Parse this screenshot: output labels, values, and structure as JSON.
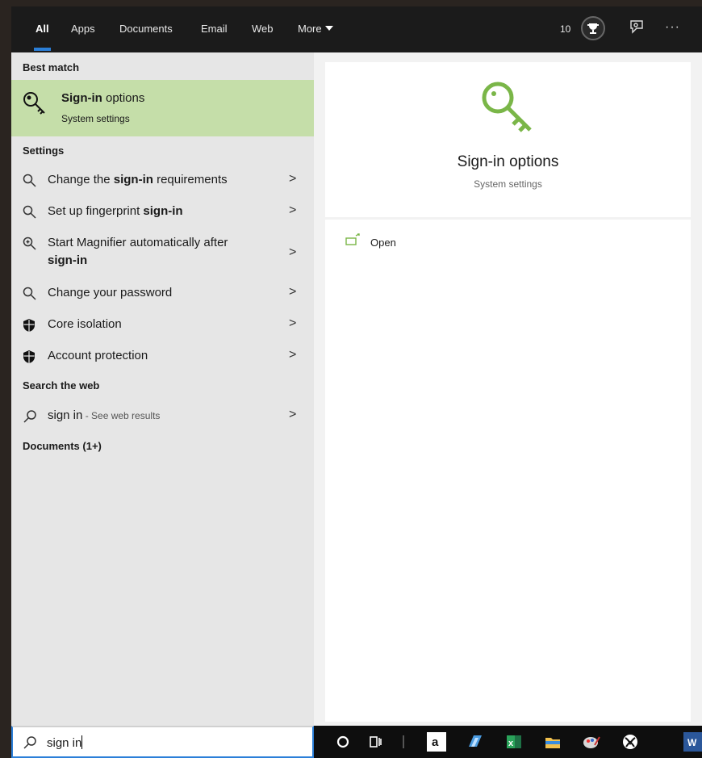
{
  "topbar": {
    "tabs": [
      "All",
      "Apps",
      "Documents",
      "Email",
      "Web",
      "More"
    ],
    "points": "10"
  },
  "left": {
    "best_match_label": "Best match",
    "best_match": {
      "title_bold": "Sign-in",
      "title_rest": " options",
      "subtitle": "System settings"
    },
    "settings_label": "Settings",
    "settings_items": [
      {
        "pre": "Change the ",
        "bold": "sign-in",
        "post": " requirements"
      },
      {
        "pre": "Set up fingerprint ",
        "bold": "sign-in",
        "post": ""
      },
      {
        "pre": "Start Magnifier automatically after",
        "bold": "sign-in",
        "post": ""
      },
      {
        "pre": "Change your password",
        "bold": "",
        "post": ""
      },
      {
        "pre": "Core isolation",
        "bold": "",
        "post": ""
      },
      {
        "pre": "Account protection",
        "bold": "",
        "post": ""
      }
    ],
    "web_label": "Search the web",
    "web_item": {
      "query": "sign in",
      "suffix": " - See web results"
    },
    "docs_label": "Documents (1+)"
  },
  "right": {
    "title": "Sign-in options",
    "subtitle": "System settings",
    "action_open": "Open"
  },
  "search": {
    "value": "sign in"
  },
  "colors": {
    "accent": "#2b7fd8",
    "highlight": "#c5dea9",
    "key_green": "#7ab648"
  },
  "icons": {
    "key": "key-icon",
    "search": "search-icon",
    "magnifier": "magnifier-icon",
    "shield": "shield-icon",
    "open": "open-icon",
    "chevron": "chevron-right-icon"
  }
}
